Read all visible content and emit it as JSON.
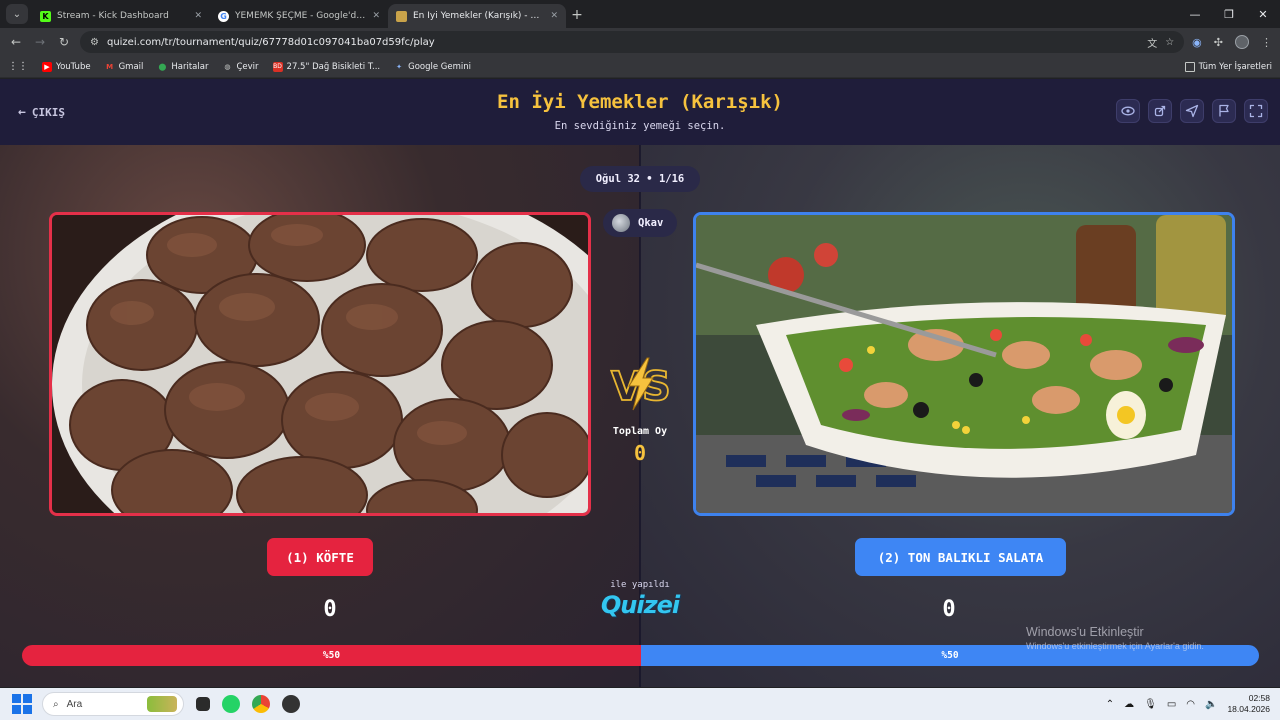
{
  "browser": {
    "tabs": [
      {
        "title": "Stream - Kick Dashboard",
        "favicon_color": "#53fc18",
        "favicon_glyph": "K"
      },
      {
        "title": "YEMEMK ŞEÇME - Google'da Ar",
        "favicon_color": "#ffffff",
        "favicon_glyph": "G"
      },
      {
        "title": "En İyi Yemekler (Karışık) - Tier L",
        "favicon_color": "#c9a34a",
        "favicon_glyph": ""
      }
    ],
    "url": "quizei.com/tr/tournament/quiz/67778d01c097041ba07d59fc/play",
    "bookmarks": [
      {
        "label": "YouTube",
        "icon": "youtube-icon",
        "color": "#ff0000"
      },
      {
        "label": "Gmail",
        "icon": "gmail-icon",
        "color": "#ea4335"
      },
      {
        "label": "Haritalar",
        "icon": "maps-icon",
        "color": "#34a853"
      },
      {
        "label": "Çevir",
        "icon": "translate-icon",
        "color": "#9aa0a6"
      },
      {
        "label": "27.5\" Dağ Bisikleti T...",
        "icon": "bd-icon",
        "color": "#d93025"
      },
      {
        "label": "Google Gemini",
        "icon": "gemini-icon",
        "color": "#8ab4f8"
      }
    ],
    "all_bookmarks": "Tüm Yer İşaretleri"
  },
  "page": {
    "exit_label": "ÇIKIŞ",
    "title": "En İyi Yemekler (Karışık)",
    "subtitle": "En sevdiğiniz yemeği seçin.",
    "round": "Oğul 32 • 1/16",
    "user": "Qkav",
    "total_votes_label": "Toplam Oy",
    "total_votes": "0",
    "left": {
      "label": "(1) KÖFTE",
      "votes": "0",
      "percent_label": "%50",
      "percent": 50,
      "color": "#e5233f"
    },
    "right": {
      "label": "(2) TON BALIKLI SALATA",
      "votes": "0",
      "percent_label": "%50",
      "percent": 50,
      "color": "#3e86f4"
    },
    "made_with": "ile yapıldı",
    "brand": "Quizei",
    "accent": "#f6c23e"
  },
  "watermark": {
    "line1": "Windows'u Etkinleştir",
    "line2": "Windows'u etkinleştirmek için Ayarlar'a gidin."
  },
  "taskbar": {
    "search_placeholder": "Ara",
    "time": "02:58",
    "date": "18.04.2026"
  }
}
